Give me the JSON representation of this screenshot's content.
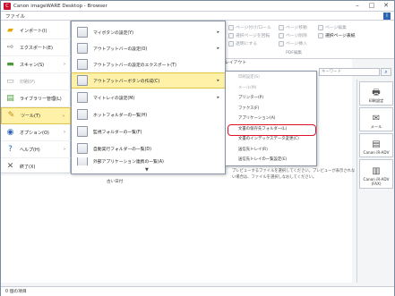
{
  "window": {
    "title": "Canon imageWARE Desktop - Browser",
    "app_badge": "C"
  },
  "menubar": {
    "file": "ファイル",
    "help_icon": "i"
  },
  "ribbon": {
    "items": [
      {
        "label": "ページ付け/ロール",
        "state": "disabled"
      },
      {
        "label": "選択ページを回転",
        "state": "disabled"
      },
      {
        "label": "透明にする",
        "state": "disabled"
      },
      {
        "label": "ページ移動",
        "state": "disabled"
      },
      {
        "label": "ページ削除",
        "state": "disabled"
      },
      {
        "label": "ページ挿入",
        "state": "disabled"
      },
      {
        "label": "ページ編集",
        "state": "disabled"
      },
      {
        "label": "選択ページ表紙",
        "state": "active"
      }
    ],
    "group_label": "PDF編集",
    "address_label": "レイアウト"
  },
  "nav": {
    "items": [
      {
        "label": "インポート(I)",
        "icon": "folder-icon"
      },
      {
        "label": "エクスポート(E)",
        "icon": "export-icon"
      },
      {
        "label": "スキャン(S)",
        "icon": "scanner-icon"
      },
      {
        "label": "印刷(P)",
        "icon": "printer-icon"
      },
      {
        "label": "ライブラリー管理(L)",
        "icon": "library-icon"
      },
      {
        "label": "ツール(T)",
        "icon": "tools-icon"
      },
      {
        "label": "オプション(O)",
        "icon": "options-icon"
      },
      {
        "label": "ヘルプ(H)",
        "icon": "help-icon"
      },
      {
        "label": "終了(X)",
        "icon": "close-icon"
      }
    ]
  },
  "submenu": {
    "items": [
      {
        "label": "マイボタンの設定(Y)"
      },
      {
        "label": "アウトプットバーの設定(O)"
      },
      {
        "label": "アウトプットバーの設定のエクスポート(T)"
      },
      {
        "label": "アウトプットバーボタンの作成(C)"
      },
      {
        "label": "マイトレイの設定(M)"
      },
      {
        "label": "ホットフォルダーの一覧(H)"
      },
      {
        "label": "監視フォルダーの一覧(F)"
      },
      {
        "label": "自動実行フォルダーの一覧(D)"
      },
      {
        "label": "外部アプリケーション連携の一覧(A)"
      }
    ],
    "scroll_indicator": "▼"
  },
  "submenu3": {
    "items": [
      {
        "label": "印刷設定(S)",
        "disabled": true
      },
      {
        "label": "メール(M)",
        "disabled": true
      },
      {
        "label": "プリンター(P)",
        "disabled": false
      },
      {
        "label": "ファクス(F)",
        "disabled": false
      },
      {
        "label": "アプリケーション(A)",
        "disabled": false
      },
      {
        "label": "文書の保存先フォルダー(L)",
        "disabled": false
      },
      {
        "label": "文書のインデックスデータ変更(C)",
        "disabled": false
      },
      {
        "label": "送信先トレイ(R)",
        "disabled": false
      },
      {
        "label": "送信先トレイの一覧設定(E)",
        "disabled": false
      }
    ]
  },
  "search": {
    "placeholder": "キーワード",
    "button_icon": "⌕"
  },
  "preview": {
    "message": "プレビューするファイルを選択してください。プレビューが表示されない場合は、ファイルを選択しなおしてください。"
  },
  "right_panel": {
    "buttons": [
      {
        "label": "印刷設定",
        "icon": "printer-icon"
      },
      {
        "label": "メール",
        "icon": "mail-icon"
      },
      {
        "label": "Canon iR-ADV",
        "icon": "mfp-icon"
      },
      {
        "label": "Canon iR-ADV (FAX)",
        "icon": "fax-icon"
      }
    ]
  },
  "tree": {
    "fragment": "古い日付"
  },
  "status": {
    "text": "0 個の項目"
  },
  "colors": {
    "highlight": "#fff2a8",
    "red_outline": "#e0102a",
    "accent": "#2d64b3"
  }
}
